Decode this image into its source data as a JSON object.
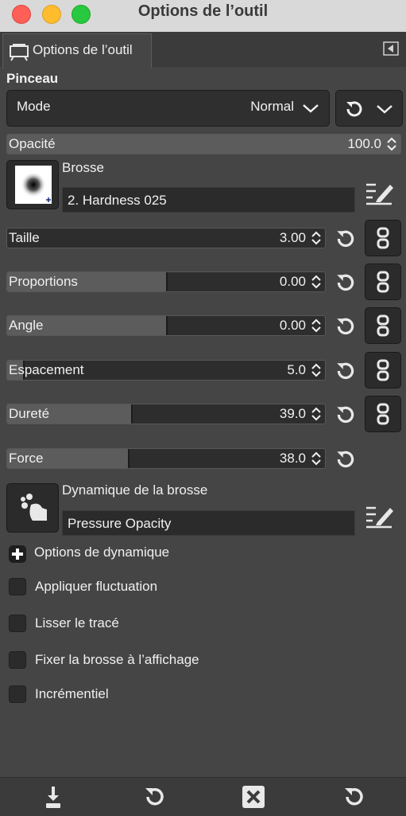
{
  "window": {
    "title": "Options de l’outil"
  },
  "tab": {
    "label": "Options de l’outil"
  },
  "section": {
    "title": "Pinceau"
  },
  "mode": {
    "label": "Mode",
    "value": "Normal"
  },
  "opacity": {
    "label": "Opacité",
    "value": "100.0",
    "fraction": 1.0
  },
  "brush": {
    "label": "Brosse",
    "value": "2. Hardness 025"
  },
  "sliders": [
    {
      "label": "Taille",
      "value": "3.00",
      "fraction": 0.0
    },
    {
      "label": "Proportions",
      "value": "0.00",
      "fraction": 0.5
    },
    {
      "label": "Angle",
      "value": "0.00",
      "fraction": 0.5
    },
    {
      "label": "Espacement",
      "value": "5.0",
      "fraction": 0.05
    },
    {
      "label": "Dureté",
      "value": "39.0",
      "fraction": 0.39
    },
    {
      "label": "Force",
      "value": "38.0",
      "fraction": 0.38
    }
  ],
  "dynamics": {
    "label": "Dynamique de la brosse",
    "value": "Pressure Opacity"
  },
  "dynamics_options": {
    "label": "Options de dynamique"
  },
  "checkboxes": [
    {
      "label": "Appliquer fluctuation",
      "checked": false
    },
    {
      "label": "Lisser le tracé",
      "checked": false
    },
    {
      "label": "Fixer la brosse à l’affichage",
      "checked": false
    },
    {
      "label": "Incrémentiel",
      "checked": false
    }
  ],
  "icons": {
    "tab": "tool-options-icon",
    "bottom": [
      "save-preset-icon",
      "restore-icon",
      "delete-icon",
      "reset-icon"
    ]
  },
  "colors": {
    "panel": "#454545",
    "field": "#2b2b2b",
    "slider_fill": "#5c5c5c",
    "text": "#f0f0f0"
  }
}
